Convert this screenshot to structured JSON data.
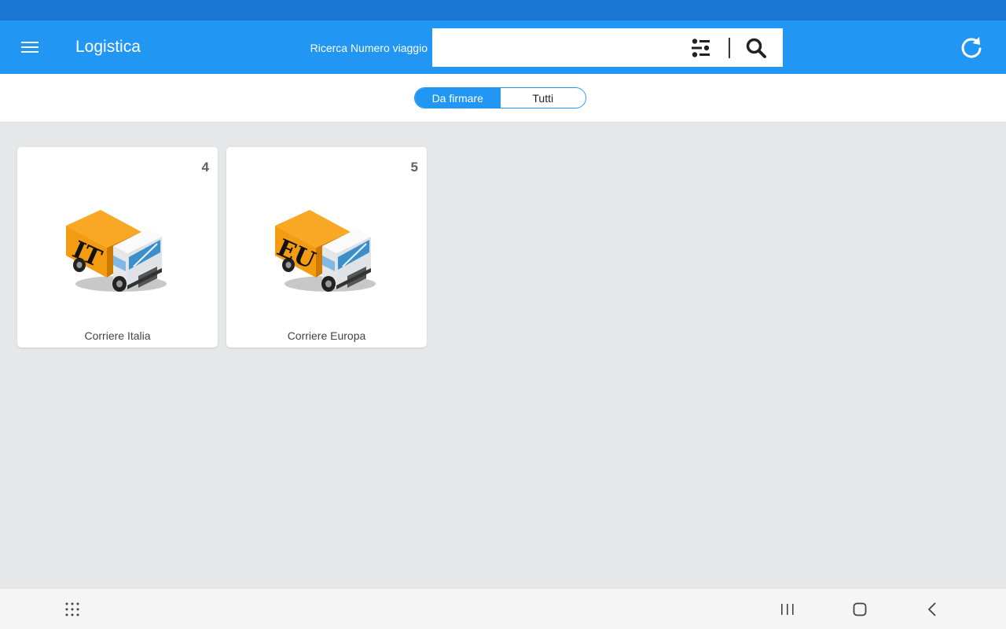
{
  "app_bar": {
    "title": "Logistica",
    "search_label": "Ricerca Numero viaggio",
    "search_value": "",
    "search_placeholder": ""
  },
  "icons": {
    "menu": "hamburger-menu-icon",
    "filter": "filter-sliders-icon",
    "search": "magnifier-icon",
    "refresh": "refresh-icon",
    "apps": "apps-grid-icon",
    "recents": "recents-icon",
    "home": "home-icon",
    "back": "back-icon"
  },
  "segments": [
    {
      "label": "Da firmare",
      "selected": true
    },
    {
      "label": "Tutti",
      "selected": false
    }
  ],
  "cards": [
    {
      "label": "Corriere Italia",
      "count": "4",
      "truck_text": "IT"
    },
    {
      "label": "Corriere Europa",
      "count": "5",
      "truck_text": "EU"
    }
  ],
  "colors": {
    "status_bar": "#1976d2",
    "app_bar": "#2196f3",
    "background": "#e6e7e9",
    "truck_cargo": "#f39c12",
    "truck_cab": "#eef0f2",
    "windshield": "#3d8fc9"
  }
}
